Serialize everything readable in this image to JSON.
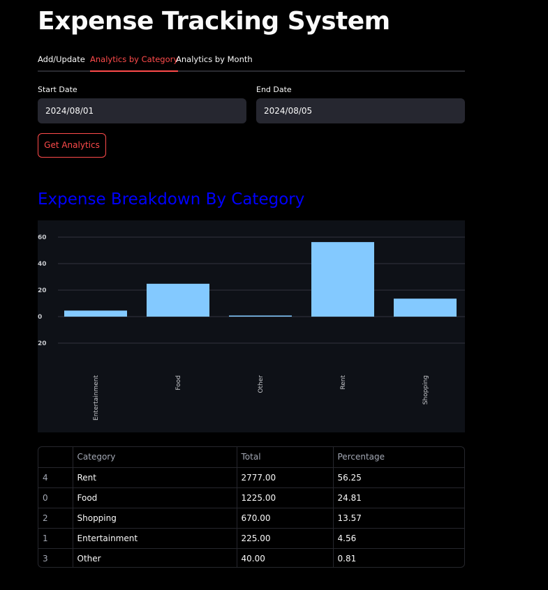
{
  "app": {
    "title": "Expense Tracking System"
  },
  "tabs": [
    {
      "label": "Add/Update",
      "active": false
    },
    {
      "label": "Analytics by Category",
      "active": true
    },
    {
      "label": "Analytics by Month",
      "active": false
    }
  ],
  "form": {
    "start_label": "Start Date",
    "start_value": "2024/08/01",
    "end_label": "End Date",
    "end_value": "2024/08/05",
    "submit_label": "Get Analytics"
  },
  "section": {
    "title": "Expense Breakdown By Category",
    "title_color": "#0000ff"
  },
  "colors": {
    "accent": "#ff4b4b",
    "bar": "#83c9ff",
    "chart_bg": "#0e1117"
  },
  "chart_data": {
    "type": "bar",
    "categories": [
      "Entertainment",
      "Food",
      "Other",
      "Rent",
      "Shopping"
    ],
    "values": [
      4.56,
      24.81,
      0.81,
      56.25,
      13.57
    ],
    "ylim": [
      -40,
      67
    ],
    "yticks": [
      60,
      40,
      20,
      0,
      20
    ],
    "ytick_values": [
      60,
      40,
      20,
      0,
      -20
    ],
    "grid": true,
    "title": "",
    "xlabel": "",
    "ylabel": ""
  },
  "table": {
    "columns": [
      "",
      "Category",
      "Total",
      "Percentage"
    ],
    "rows": [
      {
        "index": "4",
        "category": "Rent",
        "total": "2777.00",
        "percentage": "56.25"
      },
      {
        "index": "0",
        "category": "Food",
        "total": "1225.00",
        "percentage": "24.81"
      },
      {
        "index": "2",
        "category": "Shopping",
        "total": "670.00",
        "percentage": "13.57"
      },
      {
        "index": "1",
        "category": "Entertainment",
        "total": "225.00",
        "percentage": "4.56"
      },
      {
        "index": "3",
        "category": "Other",
        "total": "40.00",
        "percentage": "0.81"
      }
    ]
  }
}
